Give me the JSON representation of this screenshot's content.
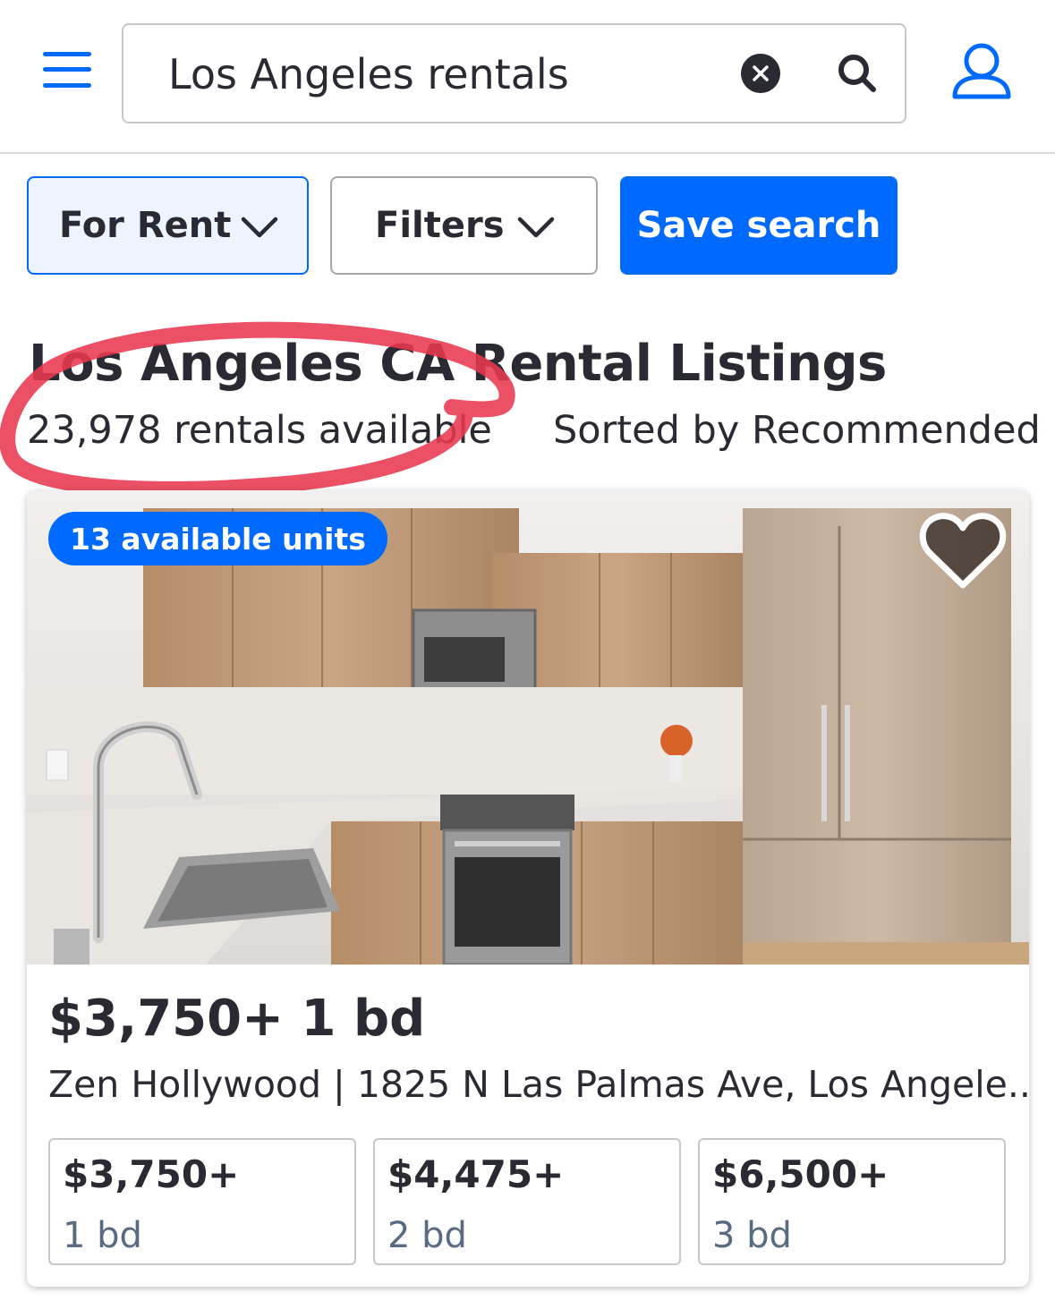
{
  "header": {
    "search_value": "Los Angeles rentals"
  },
  "filters": {
    "for_rent_label": "For Rent",
    "filters_label": "Filters",
    "save_search_label": "Save search"
  },
  "results": {
    "title": "Los Angeles CA Rental Listings",
    "count_text": "23,978 rentals available",
    "sort_text": "Sorted by Recommended"
  },
  "listing": {
    "badge": "13 available units",
    "headline": "$3,750+ 1 bd",
    "address": "Zen Hollywood | 1825 N Las Palmas Ave, Los Angele...",
    "units": [
      {
        "price": "$3,750+",
        "beds": "1 bd"
      },
      {
        "price": "$4,475+",
        "beds": "2 bd"
      },
      {
        "price": "$6,500+",
        "beds": "3 bd"
      }
    ]
  },
  "colors": {
    "brand_blue": "#006aff",
    "annotation_red": "#e8384f",
    "text": "#2a2a33"
  },
  "icons": [
    "hamburger-menu-icon",
    "clear-icon",
    "search-icon",
    "user-icon",
    "chevron-down-icon",
    "heart-icon"
  ]
}
